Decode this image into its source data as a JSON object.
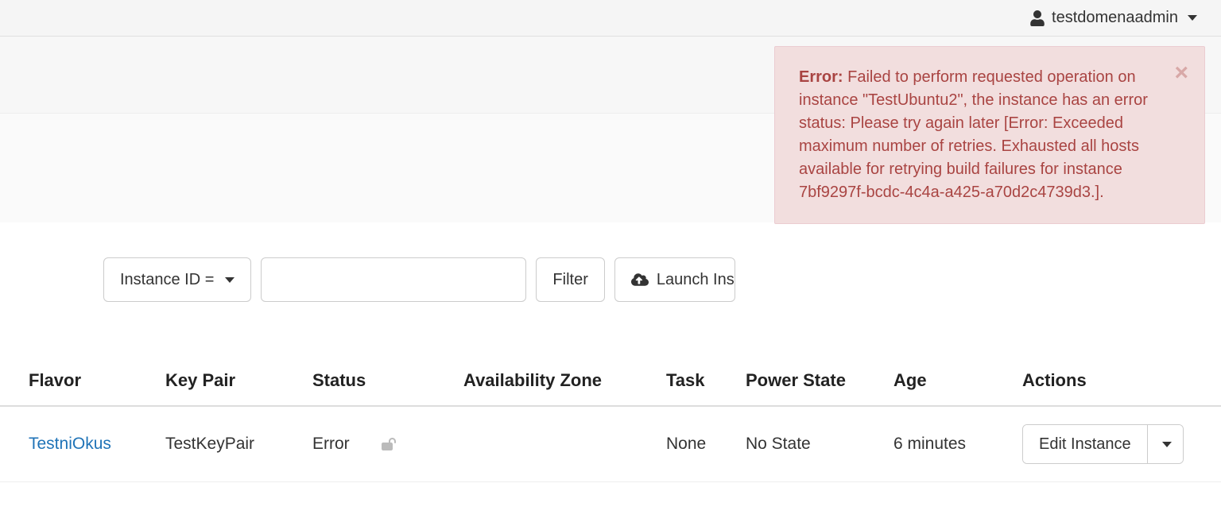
{
  "header": {
    "username": "testdomenaadmin"
  },
  "alert": {
    "title": "Error:",
    "message": "Failed to perform requested operation on instance \"TestUbuntu2\", the instance has an error status: Please try again later [Error: Exceeded maximum number of retries. Exhausted all hosts available for retrying build failures for instance 7bf9297f-bcdc-4c4a-a425-a70d2c4739d3.]."
  },
  "toolbar": {
    "filter_field_label": "Instance ID =",
    "search_value": "",
    "filter_button": "Filter",
    "launch_button": "Launch Ins"
  },
  "table": {
    "headers": {
      "flavor": "Flavor",
      "keypair": "Key Pair",
      "status": "Status",
      "az": "Availability Zone",
      "task": "Task",
      "power": "Power State",
      "age": "Age",
      "actions": "Actions"
    },
    "rows": [
      {
        "flavor": "TestniOkus",
        "keypair": "TestKeyPair",
        "status": "Error",
        "az": "",
        "task": "None",
        "power": "No State",
        "age": "6 minutes",
        "action_label": "Edit Instance"
      }
    ]
  }
}
